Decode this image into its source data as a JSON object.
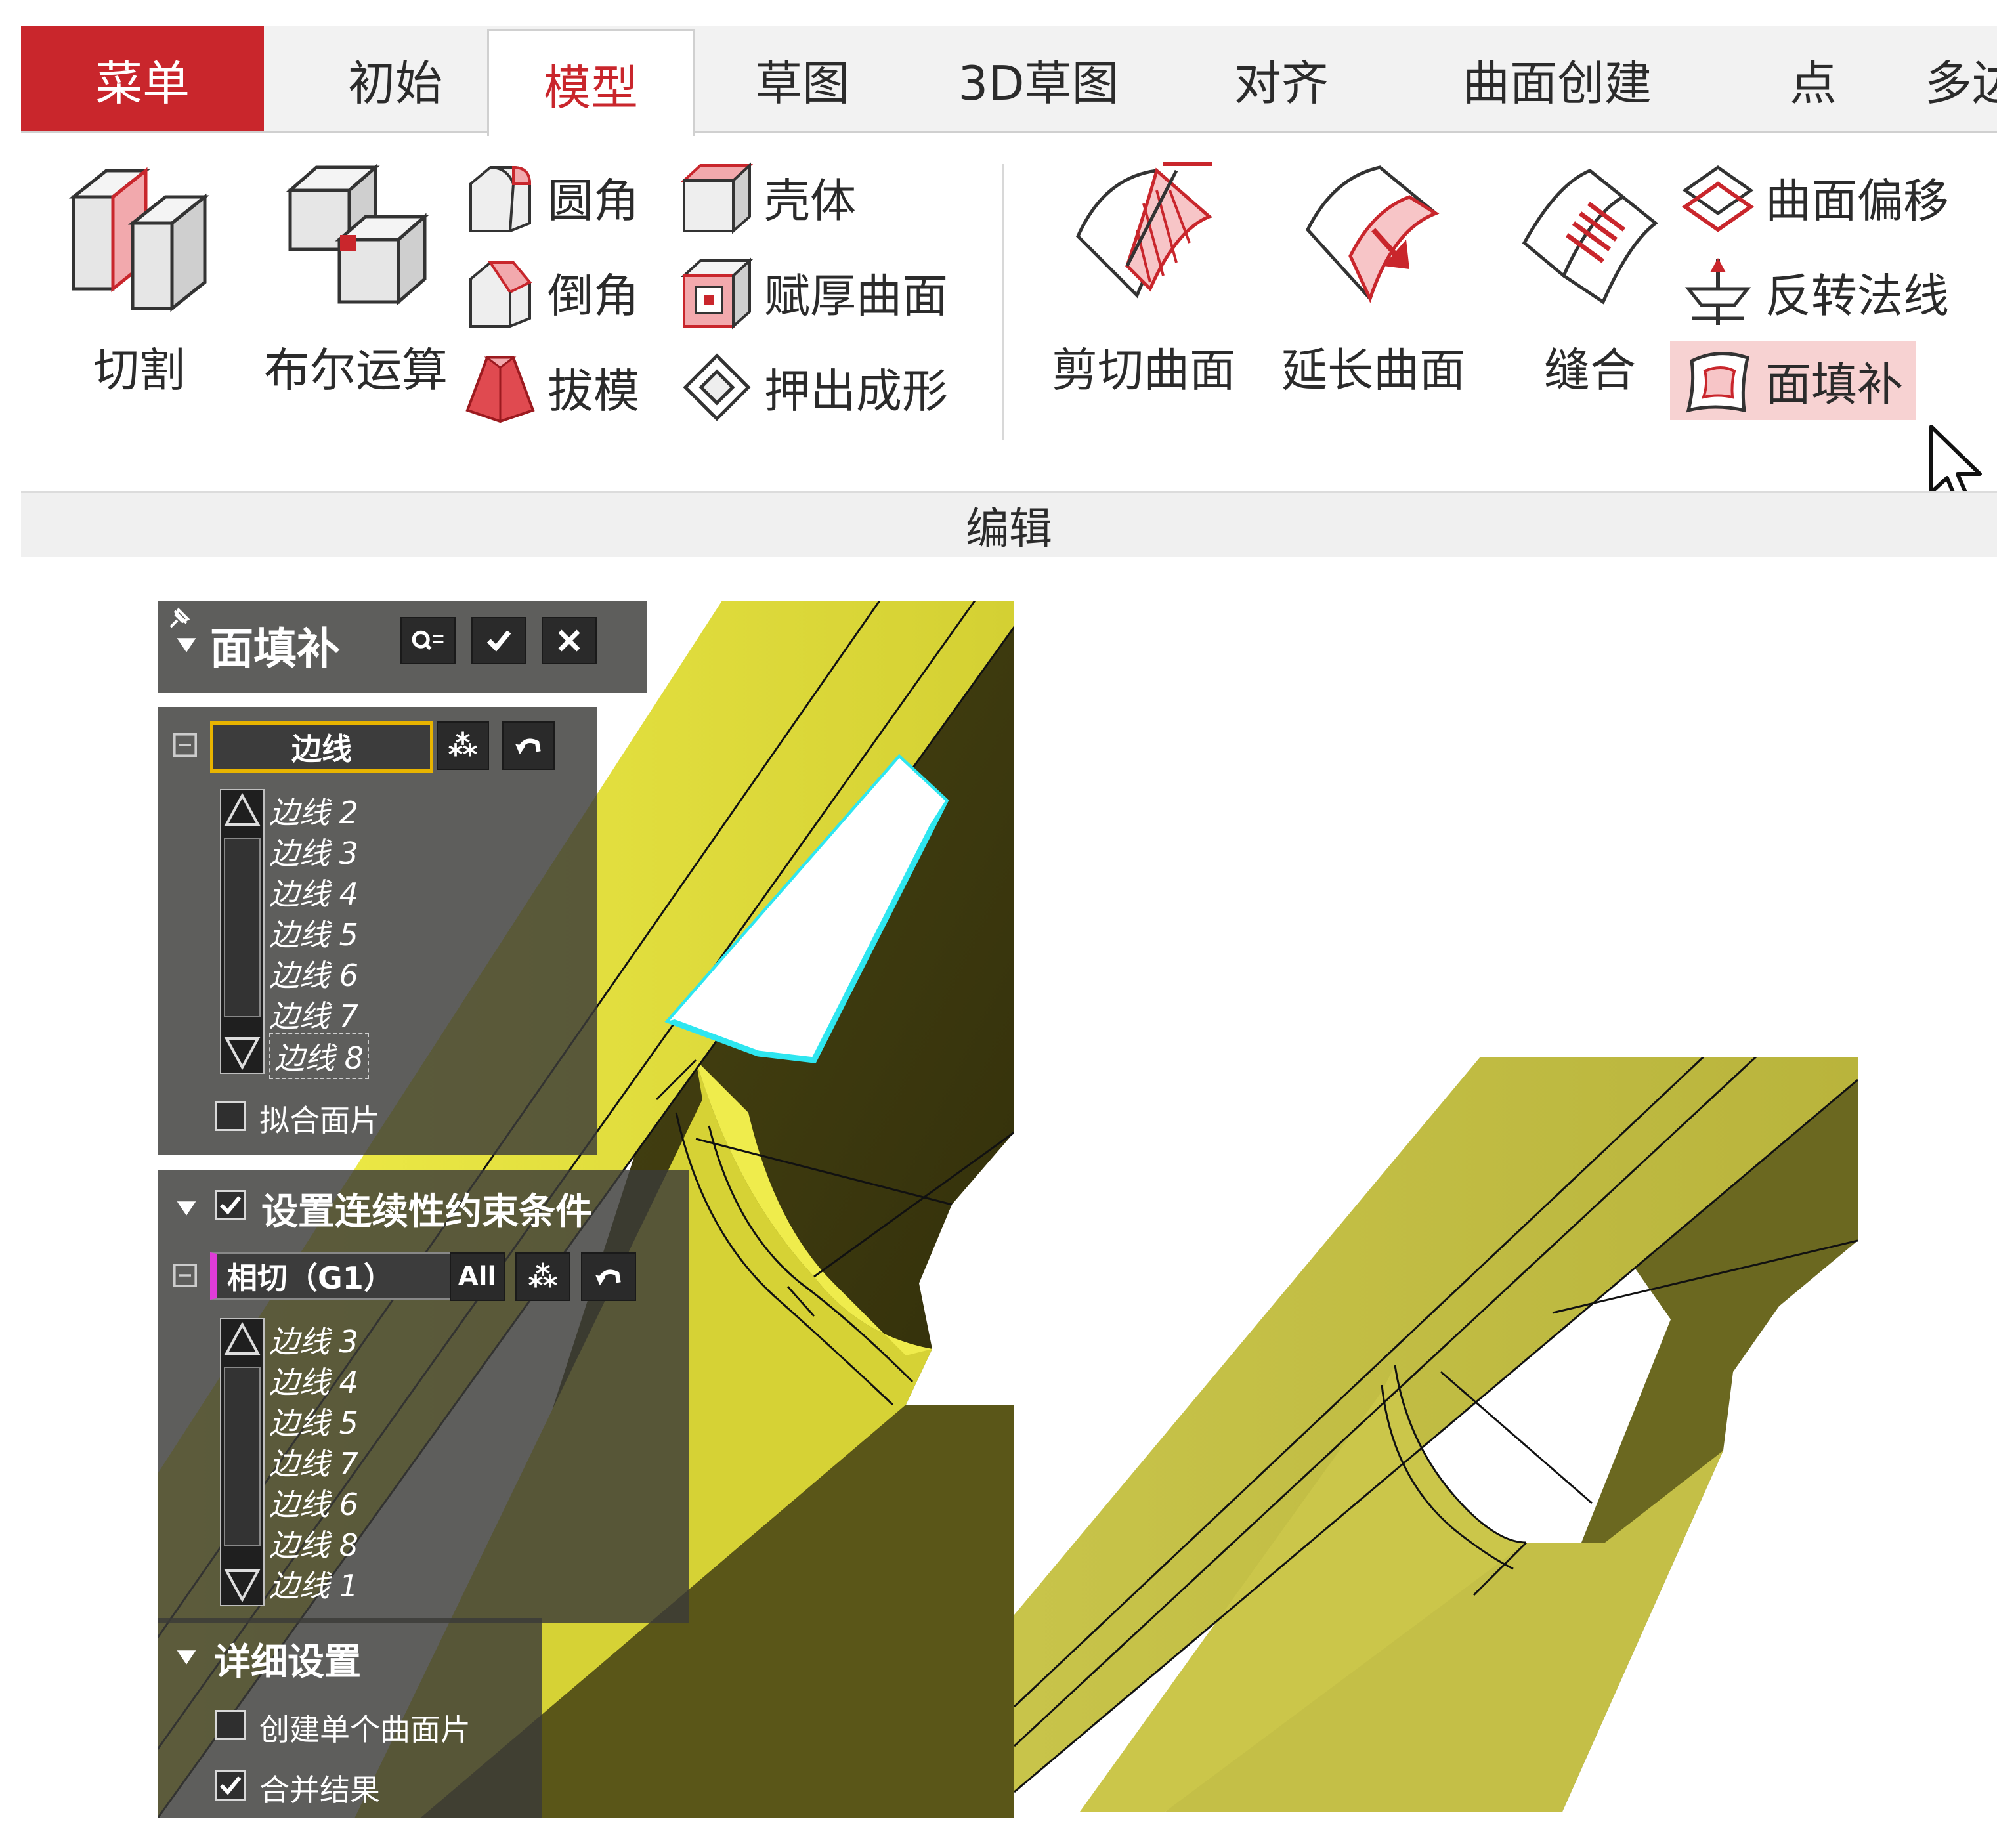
{
  "tabs": [
    {
      "label": "菜单"
    },
    {
      "label": "初始"
    },
    {
      "label": "模型"
    },
    {
      "label": "草图"
    },
    {
      "label": "3D草图"
    },
    {
      "label": "对齐"
    },
    {
      "label": "曲面创建"
    },
    {
      "label": "点"
    },
    {
      "label": "多边"
    }
  ],
  "tools": {
    "cut": "切割",
    "boolean": "布尔运算",
    "fillet": "圆角",
    "chamfer": "倒角",
    "draft": "拔模",
    "shell": "壳体",
    "thicken": "赋厚曲面",
    "emboss": "押出成形",
    "trim_surface": "剪切曲面",
    "extend_surface": "延长曲面",
    "stitch": "缝合",
    "offset_surface": "曲面偏移",
    "reverse_normal": "反转法线",
    "fill_face": "面填补"
  },
  "group_label": "编辑",
  "panel": {
    "title": "面填补",
    "edge_field": "边线",
    "edge_items": [
      "边线 2",
      "边线 3",
      "边线 4",
      "边线 5",
      "边线 6",
      "边线 7",
      "边线 8"
    ],
    "fit_patch": "拟合面片",
    "continuity_title": "设置连续性约束条件",
    "continuity_field": "相切（G1）",
    "all_label": "All",
    "continuity_items": [
      "边线 3",
      "边线 4",
      "边线 5",
      "边线 7",
      "边线 6",
      "边线 8",
      "边线 1"
    ],
    "detail_title": "详细设置",
    "single_patch": "创建单个曲面片",
    "merge_result": "合并结果"
  },
  "colors": {
    "accent": "#c9262c",
    "model_yellow": "#d8d43a",
    "highlight_cyan": "#2ee6f0",
    "field_border": "#e8b400"
  },
  "icons": {
    "pick": "zoom-pick-icon",
    "ok": "check-icon",
    "cancel": "close-icon",
    "clear": "asterisk-icon",
    "undo": "undo-icon"
  }
}
